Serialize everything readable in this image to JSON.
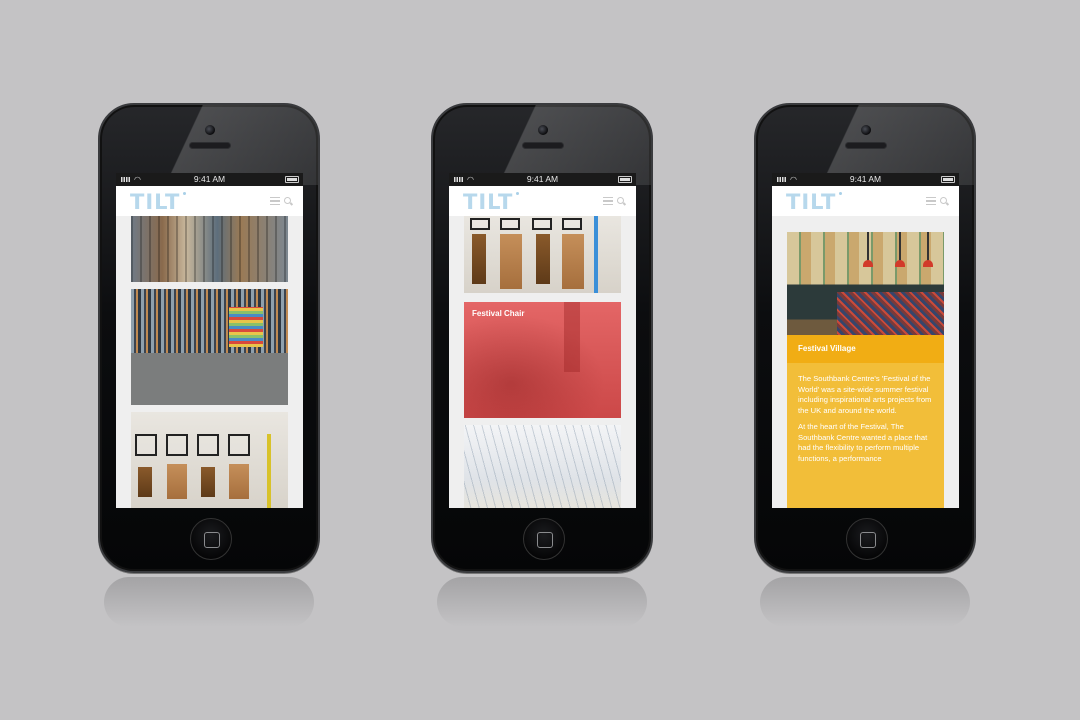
{
  "status_bar": {
    "time": "9:41 AM"
  },
  "app": {
    "logo": "TILT"
  },
  "phone2": {
    "card_title": "Festival Chair"
  },
  "phone3": {
    "band_title": "Festival Village",
    "para1": "The Southbank Centre's 'Festival of the World' was a site-wide summer festival including inspirational arts projects from the UK and around the world.",
    "para2": "At the heart of the Festival, The Southbank Centre wanted a place that had the flexibility to perform multiple functions, a performance"
  },
  "colors": {
    "background": "#c4c3c5",
    "logo_blue": "#b7d8ec",
    "festival_red": "#e05a5a",
    "festival_yellow": "#f1ad14"
  },
  "icons": [
    "wifi-icon",
    "battery-icon",
    "menu-icon",
    "search-icon",
    "home-button-icon"
  ]
}
